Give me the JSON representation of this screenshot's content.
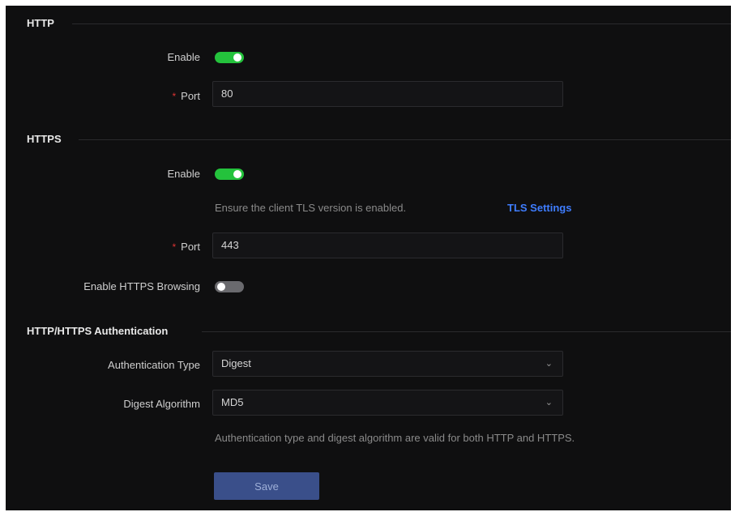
{
  "http": {
    "title": "HTTP",
    "enable_label": "Enable",
    "enable_on": true,
    "port_label": "Port",
    "port_required_mark": "*",
    "port_value": "80"
  },
  "https": {
    "title": "HTTPS",
    "enable_label": "Enable",
    "enable_on": true,
    "tls_hint": "Ensure the client TLS version is enabled.",
    "tls_link": "TLS Settings",
    "port_label": "Port",
    "port_required_mark": "*",
    "port_value": "443",
    "browsing_label": "Enable HTTPS Browsing",
    "browsing_on": false
  },
  "auth": {
    "title": "HTTP/HTTPS Authentication",
    "type_label": "Authentication Type",
    "type_value": "Digest",
    "algo_label": "Digest Algorithm",
    "algo_value": "MD5",
    "note": "Authentication type and digest algorithm are valid for both HTTP and HTTPS."
  },
  "actions": {
    "save_label": "Save"
  },
  "colors": {
    "toggle_on": "#24c23c",
    "toggle_off": "#6a6a6e",
    "link": "#3f7dff",
    "required": "#dd3333",
    "save_button": "#3a4f8a"
  },
  "icons": {
    "select_chevron": "chevron-down-icon"
  }
}
